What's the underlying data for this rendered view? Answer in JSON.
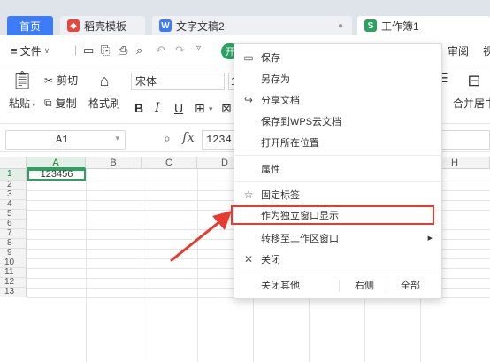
{
  "tabs": {
    "home": "首页",
    "template": "稻壳模板",
    "doc": "文字文稿2",
    "sheet": "工作簿1"
  },
  "toolbar": {
    "file_menu": "文件",
    "start_pill": "开",
    "review_tab": "审阅",
    "paste": "粘贴",
    "cut": "剪切",
    "copy": "复制",
    "format_painter": "格式刷",
    "font_name": "宋体",
    "font_size": "1",
    "merge_center": "合并居中"
  },
  "formula_bar": {
    "name_box": "A1",
    "fx_label": "fx",
    "content": "1234"
  },
  "grid": {
    "columns": [
      "A",
      "B",
      "C",
      "D",
      "E",
      "F",
      "G",
      "H"
    ],
    "rows": [
      "1",
      "2",
      "3",
      "4",
      "5",
      "6",
      "7",
      "8",
      "9",
      "10",
      "11",
      "12",
      "13"
    ],
    "a1_value": "123456"
  },
  "context_menu": {
    "save": "保存",
    "save_as": "另存为",
    "share_doc": "分享文档",
    "save_to_cloud": "保存到WPS云文档",
    "open_location": "打开所在位置",
    "properties": "属性",
    "pin_tab": "固定标签",
    "open_separate_window": "作为独立窗口显示",
    "move_to_workspace": "转移至工作区窗口",
    "close": "关闭",
    "close_others": "关闭其他",
    "close_right": "右侧",
    "close_all": "全部"
  },
  "colors": {
    "accent_blue": "#3c7cf6",
    "accent_green": "#2aa361",
    "highlight_red": "#e63b2e"
  }
}
